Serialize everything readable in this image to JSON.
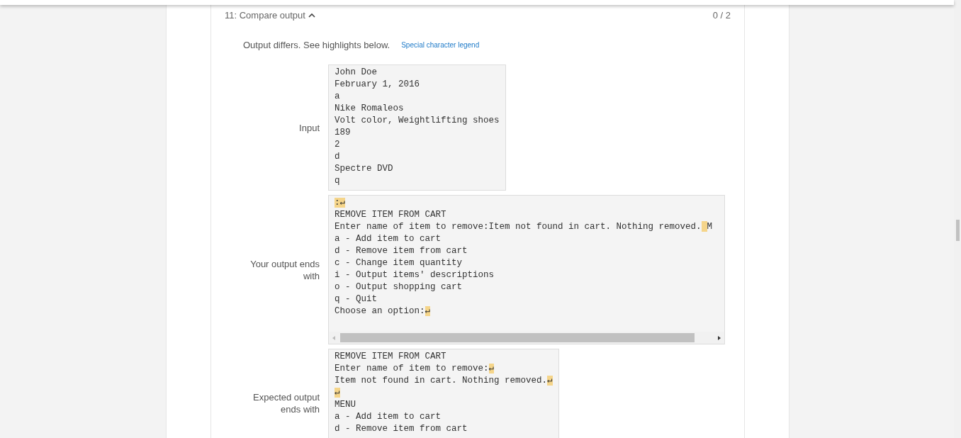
{
  "section": {
    "title": "11: Compare output",
    "expanded": true,
    "score": "0 / 2"
  },
  "message": "Output differs. See highlights below.",
  "legend_link": "Special character legend",
  "blocks": [
    {
      "label": "Input",
      "scrollbar": false,
      "lines": [
        [
          {
            "text": "John Doe",
            "highlight": false
          }
        ],
        [
          {
            "text": "February 1, 2016",
            "highlight": false
          }
        ],
        [
          {
            "text": "a",
            "highlight": false
          }
        ],
        [
          {
            "text": "Nike Romaleos",
            "highlight": false
          }
        ],
        [
          {
            "text": "Volt color, Weightlifting shoes",
            "highlight": false
          }
        ],
        [
          {
            "text": "189",
            "highlight": false
          }
        ],
        [
          {
            "text": "2",
            "highlight": false
          }
        ],
        [
          {
            "text": "d",
            "highlight": false
          }
        ],
        [
          {
            "text": "Spectre DVD",
            "highlight": false
          }
        ],
        [
          {
            "text": "q",
            "highlight": false
          }
        ]
      ]
    },
    {
      "label": "Your output ends with",
      "scrollbar": true,
      "lines": [
        [
          {
            "text": ":↵",
            "highlight": true
          }
        ],
        [
          {
            "text": "REMOVE ITEM FROM CART",
            "highlight": false
          }
        ],
        [
          {
            "text": "Enter name of item to remove:Item not found in cart. Nothing removed.",
            "highlight": false
          },
          {
            "highlight": true
          },
          {
            "text": "M",
            "highlight": false
          }
        ],
        [
          {
            "text": "a - Add item to cart",
            "highlight": false
          }
        ],
        [
          {
            "text": "d - Remove item from cart",
            "highlight": false
          }
        ],
        [
          {
            "text": "c - Change item quantity",
            "highlight": false
          }
        ],
        [
          {
            "text": "i - Output items' descriptions",
            "highlight": false
          }
        ],
        [
          {
            "text": "o - Output shopping cart",
            "highlight": false
          }
        ],
        [
          {
            "text": "q - Quit",
            "highlight": false
          }
        ],
        [
          {
            "text": "Choose an option:",
            "highlight": false
          },
          {
            "text": "↵",
            "highlight": true
          }
        ]
      ]
    },
    {
      "label": "Expected output ends with",
      "scrollbar": false,
      "lines": [
        [
          {
            "text": "REMOVE ITEM FROM CART",
            "highlight": false
          }
        ],
        [
          {
            "text": "Enter name of item to remove:",
            "highlight": false
          },
          {
            "text": "↵",
            "highlight": true
          }
        ],
        [
          {
            "text": "Item not found in cart. Nothing removed.",
            "highlight": false
          },
          {
            "text": "↵",
            "highlight": true
          }
        ],
        [
          {
            "text": "↵",
            "highlight": true
          }
        ],
        [
          {
            "text": "MENU",
            "highlight": false
          }
        ],
        [
          {
            "text": "a - Add item to cart",
            "highlight": false
          }
        ],
        [
          {
            "text": "d - Remove item from cart",
            "highlight": false
          }
        ]
      ]
    }
  ]
}
